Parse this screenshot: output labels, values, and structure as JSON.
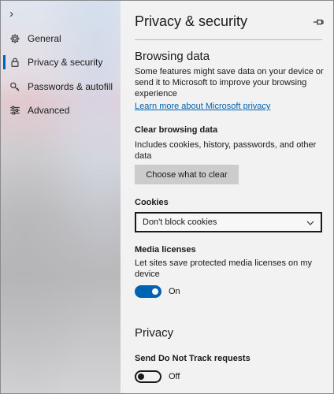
{
  "sidebar": {
    "items": [
      {
        "label": "General",
        "icon": "gear-icon"
      },
      {
        "label": "Privacy & security",
        "icon": "lock-icon",
        "active": true
      },
      {
        "label": "Passwords & autofill",
        "icon": "key-icon"
      },
      {
        "label": "Advanced",
        "icon": "sliders-icon"
      }
    ]
  },
  "main": {
    "title": "Privacy & security",
    "browsing": {
      "heading": "Browsing data",
      "description": "Some features might save data on your device or send it to Microsoft to improve your browsing experience",
      "link": "Learn more about Microsoft privacy"
    },
    "clear": {
      "label": "Clear browsing data",
      "description": "Includes cookies, history, passwords, and other data",
      "button": "Choose what to clear"
    },
    "cookies": {
      "label": "Cookies",
      "selected": "Don't block cookies"
    },
    "media": {
      "label": "Media licenses",
      "description": "Let sites save protected media licenses on my device",
      "state": "On",
      "enabled": true
    },
    "privacy": {
      "heading": "Privacy",
      "dnt_label": "Send Do Not Track requests",
      "dnt_state": "Off",
      "dnt_enabled": false
    }
  },
  "colors": {
    "accent": "#0063b1",
    "panel_bg": "#f2f2f2",
    "button_bg": "#cccccc"
  }
}
